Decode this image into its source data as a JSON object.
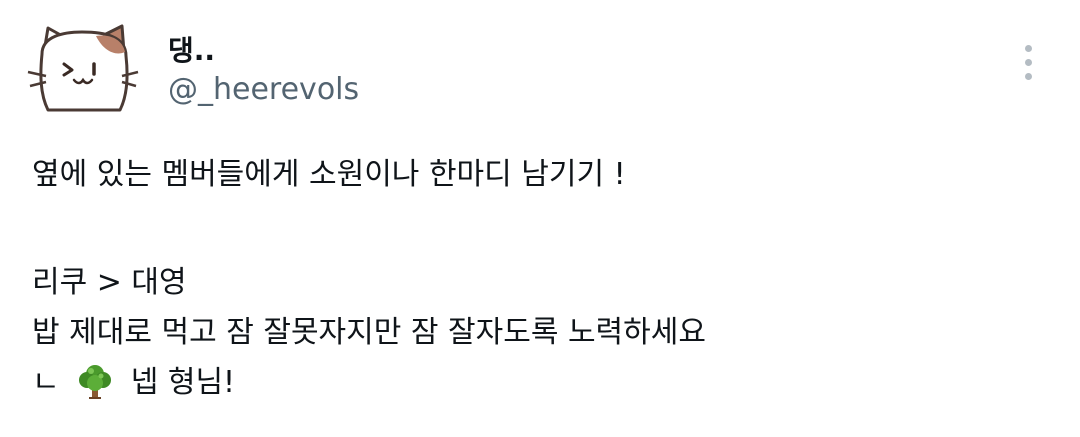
{
  "author": {
    "display_name": "댕..",
    "handle": "@_heerevols"
  },
  "tweet": {
    "line1": "옆에 있는 멤버들에게 소원이나 한마디 남기기 !",
    "line2": "리쿠 > 대영",
    "line3": "밥 제대로 먹고 잠 잘못자지만 잠 잘자도록 노력하세요",
    "line4_prefix": "ㄴ",
    "line4_suffix": "넵 형님!"
  },
  "icons": {
    "avatar": "cat-face-avatar-icon",
    "more": "more-options-vertical-icon",
    "emoji": "deciduous-tree-emoji-icon"
  },
  "colors": {
    "handle": "#536471",
    "text": "#0f1419",
    "more_dots": "#b4bcc3"
  }
}
